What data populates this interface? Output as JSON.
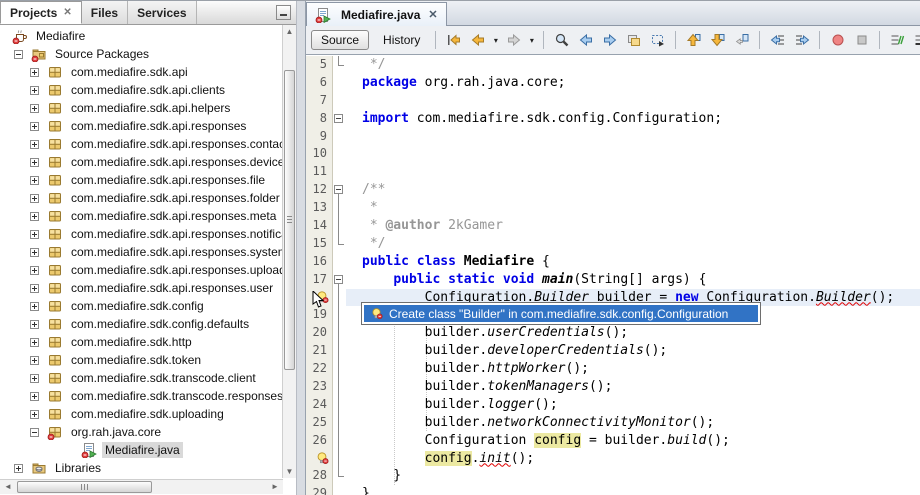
{
  "colors": {
    "selection_blue": "#3173c5",
    "keyword": "#0000e6",
    "comment": "#969696",
    "error_underline": "#e00000",
    "occurrence_highlight": "#ece9a2",
    "current_line": "#e7eef8",
    "gutter_bg": "#f0efe7",
    "package_icon_gold": "#ecc96d"
  },
  "left_panel": {
    "tabs": [
      {
        "label": "Projects",
        "active": true,
        "close": true
      },
      {
        "label": "Files",
        "active": false,
        "close": false
      },
      {
        "label": "Services",
        "active": false,
        "close": false
      }
    ],
    "minimize_icon": "minimize-window-icon",
    "tree": [
      {
        "label": "Mediafire",
        "level": 0,
        "icon": "project",
        "expander": "",
        "error": true
      },
      {
        "label": "Source Packages",
        "level": 1,
        "icon": "packages-folder",
        "expander": "minus",
        "error": true
      },
      {
        "label": "com.mediafire.sdk.api",
        "level": 2,
        "icon": "package",
        "expander": "plus"
      },
      {
        "label": "com.mediafire.sdk.api.clients",
        "level": 2,
        "icon": "package",
        "expander": "plus"
      },
      {
        "label": "com.mediafire.sdk.api.helpers",
        "level": 2,
        "icon": "package",
        "expander": "plus"
      },
      {
        "label": "com.mediafire.sdk.api.responses",
        "level": 2,
        "icon": "package",
        "expander": "plus"
      },
      {
        "label": "com.mediafire.sdk.api.responses.contact",
        "level": 2,
        "icon": "package",
        "expander": "plus"
      },
      {
        "label": "com.mediafire.sdk.api.responses.device",
        "level": 2,
        "icon": "package",
        "expander": "plus"
      },
      {
        "label": "com.mediafire.sdk.api.responses.file",
        "level": 2,
        "icon": "package",
        "expander": "plus"
      },
      {
        "label": "com.mediafire.sdk.api.responses.folder",
        "level": 2,
        "icon": "package",
        "expander": "plus"
      },
      {
        "label": "com.mediafire.sdk.api.responses.meta",
        "level": 2,
        "icon": "package",
        "expander": "plus"
      },
      {
        "label": "com.mediafire.sdk.api.responses.notification",
        "level": 2,
        "icon": "package",
        "expander": "plus"
      },
      {
        "label": "com.mediafire.sdk.api.responses.system",
        "level": 2,
        "icon": "package",
        "expander": "plus"
      },
      {
        "label": "com.mediafire.sdk.api.responses.upload",
        "level": 2,
        "icon": "package",
        "expander": "plus"
      },
      {
        "label": "com.mediafire.sdk.api.responses.user",
        "level": 2,
        "icon": "package",
        "expander": "plus"
      },
      {
        "label": "com.mediafire.sdk.config",
        "level": 2,
        "icon": "package",
        "expander": "plus"
      },
      {
        "label": "com.mediafire.sdk.config.defaults",
        "level": 2,
        "icon": "package",
        "expander": "plus"
      },
      {
        "label": "com.mediafire.sdk.http",
        "level": 2,
        "icon": "package",
        "expander": "plus"
      },
      {
        "label": "com.mediafire.sdk.token",
        "level": 2,
        "icon": "package",
        "expander": "plus"
      },
      {
        "label": "com.mediafire.sdk.transcode.client",
        "level": 2,
        "icon": "package",
        "expander": "plus"
      },
      {
        "label": "com.mediafire.sdk.transcode.responses",
        "level": 2,
        "icon": "package",
        "expander": "plus"
      },
      {
        "label": "com.mediafire.sdk.uploading",
        "level": 2,
        "icon": "package",
        "expander": "plus"
      },
      {
        "label": "org.rah.java.core",
        "level": 2,
        "icon": "package",
        "expander": "minus",
        "error": true
      },
      {
        "label": "Mediafire.java",
        "level": 3,
        "icon": "class",
        "expander": "",
        "error": true,
        "selected": true
      },
      {
        "label": "Libraries",
        "level": 1,
        "icon": "libraries",
        "expander": "plus"
      }
    ]
  },
  "editor": {
    "tab": {
      "label": "Mediafire.java",
      "icon": "class",
      "close_icon": "close-icon"
    },
    "toolbar": {
      "source_label": "Source",
      "history_label": "History",
      "icons": [
        {
          "name": "jump-last-edit"
        },
        {
          "name": "back"
        },
        {
          "name": "back-dropdown",
          "dd": true
        },
        {
          "name": "forward"
        },
        {
          "name": "forward-dropdown",
          "dd": true
        },
        {
          "sep": true
        },
        {
          "name": "find-selection"
        },
        {
          "name": "find-previous"
        },
        {
          "name": "find-next"
        },
        {
          "name": "toggle-highlight"
        },
        {
          "name": "rectangular-selection"
        },
        {
          "sep": true
        },
        {
          "name": "previous-bookmark"
        },
        {
          "name": "next-bookmark"
        },
        {
          "name": "toggle-bookmark"
        },
        {
          "sep": true
        },
        {
          "name": "shift-line-left"
        },
        {
          "name": "shift-line-right"
        },
        {
          "sep": true
        },
        {
          "name": "start-macro-recording"
        },
        {
          "name": "stop-macro-recording"
        },
        {
          "sep": true
        },
        {
          "name": "comment"
        },
        {
          "name": "uncomment"
        }
      ]
    },
    "popup": {
      "icon": "hint-bulb-icon",
      "text": "Create class \"Builder\" in com.mediafire.sdk.config.Configuration"
    },
    "code": {
      "lines": [
        {
          "n": "5",
          "g": "num",
          "f": "end",
          "seg": [
            [
              " */",
              "c"
            ]
          ]
        },
        {
          "n": "6",
          "g": "num",
          "f": "",
          "seg": [
            [
              "package",
              "k"
            ],
            [
              " org.rah.java.core;",
              "p"
            ]
          ]
        },
        {
          "n": "7",
          "g": "num",
          "f": "",
          "seg": []
        },
        {
          "n": "8",
          "g": "num",
          "f": "box",
          "seg": [
            [
              "import",
              "k"
            ],
            [
              " com.mediafire.sdk.config.Configuration;",
              "p"
            ]
          ]
        },
        {
          "n": "9",
          "g": "num",
          "f": "",
          "seg": []
        },
        {
          "n": "10",
          "g": "num",
          "f": "",
          "seg": []
        },
        {
          "n": "11",
          "g": "num",
          "f": "",
          "seg": []
        },
        {
          "n": "12",
          "g": "num",
          "f": "start",
          "seg": [
            [
              "/**",
              "c"
            ]
          ]
        },
        {
          "n": "13",
          "g": "num",
          "f": "mid",
          "seg": [
            [
              " *",
              "c"
            ]
          ]
        },
        {
          "n": "14",
          "g": "num",
          "f": "mid",
          "seg": [
            [
              " * ",
              "c"
            ],
            [
              "@author",
              "cb"
            ],
            [
              " 2kGamer",
              "c"
            ]
          ]
        },
        {
          "n": "15",
          "g": "num",
          "f": "end",
          "seg": [
            [
              " */",
              "c"
            ]
          ]
        },
        {
          "n": "16",
          "g": "num",
          "f": "",
          "seg": [
            [
              "public",
              "k"
            ],
            [
              " ",
              "p"
            ],
            [
              "class",
              "k"
            ],
            [
              " ",
              "p"
            ],
            [
              "Mediafire",
              "bd"
            ],
            [
              " {",
              "p"
            ]
          ]
        },
        {
          "n": "17",
          "g": "num",
          "f": "start",
          "seg": [
            [
              "    ",
              "p"
            ],
            [
              "public",
              "k"
            ],
            [
              " ",
              "p"
            ],
            [
              "static",
              "k"
            ],
            [
              " ",
              "p"
            ],
            [
              "void",
              "k"
            ],
            [
              " ",
              "p"
            ],
            [
              "main",
              "bi"
            ],
            [
              "(String[] args) {",
              "p"
            ]
          ]
        },
        {
          "n": "18",
          "g": "bulb",
          "f": "mid",
          "cur": true,
          "seg": [
            [
              "        Configuration.",
              "p"
            ],
            [
              "Builder",
              "ie"
            ],
            [
              " builder = ",
              "p"
            ],
            [
              "new",
              "k"
            ],
            [
              " Configuration.",
              "p"
            ],
            [
              "Builder",
              "ie"
            ],
            [
              "();",
              "p"
            ]
          ]
        },
        {
          "n": "19",
          "g": "num",
          "f": "mid",
          "seg": []
        },
        {
          "n": "20",
          "g": "num",
          "f": "mid",
          "seg": [
            [
              "        builder.",
              "p"
            ],
            [
              "userCredentials",
              "i"
            ],
            [
              "();",
              "p"
            ]
          ]
        },
        {
          "n": "21",
          "g": "num",
          "f": "mid",
          "seg": [
            [
              "        builder.",
              "p"
            ],
            [
              "developerCredentials",
              "i"
            ],
            [
              "();",
              "p"
            ]
          ]
        },
        {
          "n": "22",
          "g": "num",
          "f": "mid",
          "seg": [
            [
              "        builder.",
              "p"
            ],
            [
              "httpWorker",
              "i"
            ],
            [
              "();",
              "p"
            ]
          ]
        },
        {
          "n": "23",
          "g": "num",
          "f": "mid",
          "seg": [
            [
              "        builder.",
              "p"
            ],
            [
              "tokenManagers",
              "i"
            ],
            [
              "();",
              "p"
            ]
          ]
        },
        {
          "n": "24",
          "g": "num",
          "f": "mid",
          "seg": [
            [
              "        builder.",
              "p"
            ],
            [
              "logger",
              "i"
            ],
            [
              "();",
              "p"
            ]
          ]
        },
        {
          "n": "25",
          "g": "num",
          "f": "mid",
          "seg": [
            [
              "        builder.",
              "p"
            ],
            [
              "networkConnectivityMonitor",
              "i"
            ],
            [
              "();",
              "p"
            ]
          ]
        },
        {
          "n": "26",
          "g": "num",
          "f": "mid",
          "seg": [
            [
              "        Configuration ",
              "p"
            ],
            [
              "config",
              "y"
            ],
            [
              " = builder.",
              "p"
            ],
            [
              "build",
              "i"
            ],
            [
              "();",
              "p"
            ]
          ]
        },
        {
          "n": "27",
          "g": "bulb",
          "f": "mid",
          "seg": [
            [
              "        ",
              "p"
            ],
            [
              "config",
              "y"
            ],
            [
              ".",
              "p"
            ],
            [
              "init",
              "ie"
            ],
            [
              "();",
              "p"
            ]
          ]
        },
        {
          "n": "28",
          "g": "num",
          "f": "end",
          "seg": [
            [
              "    }",
              "p"
            ]
          ]
        },
        {
          "n": "29",
          "g": "num",
          "f": "",
          "seg": [
            [
              "}",
              "p"
            ]
          ]
        }
      ]
    }
  }
}
